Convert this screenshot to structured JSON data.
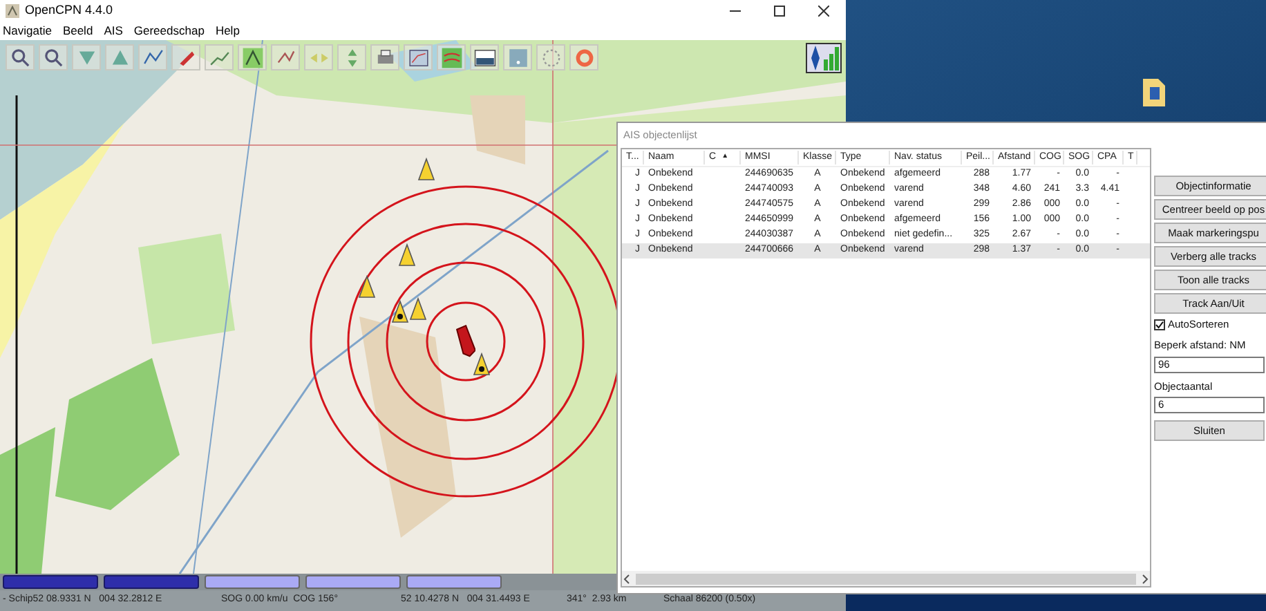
{
  "app_window": {
    "title": "OpenCPN 4.4.0",
    "menu": [
      "Navigatie",
      "Beeld",
      "AIS",
      "Gereedschap",
      "Help"
    ]
  },
  "chart_bar": [
    {
      "selected": true
    },
    {
      "selected": true
    },
    {
      "selected": false
    },
    {
      "selected": false
    },
    {
      "selected": false
    }
  ],
  "status_bar": [
    "- Schip52 08.9331 N   004 32.2812 E",
    "SOG 0.00 km/u  COG 156°",
    "52 10.4278 N   004 31.4493 E",
    "341°  2.93 km",
    "Schaal 86200 (0.50x)"
  ],
  "ais_dialog": {
    "title": "AIS objectenlijst",
    "columns": [
      {
        "label": "T..."
      },
      {
        "label": "Naam"
      },
      {
        "label": "C",
        "sort_arrow": "▲"
      },
      {
        "label": "MMSI"
      },
      {
        "label": "Klasse"
      },
      {
        "label": "Type"
      },
      {
        "label": "Nav. status"
      },
      {
        "label": "Peil..."
      },
      {
        "label": "Afstand"
      },
      {
        "label": "COG"
      },
      {
        "label": "SOG"
      },
      {
        "label": "CPA"
      },
      {
        "label": "T"
      }
    ],
    "rows": [
      {
        "t": "J",
        "naam": "Onbekend",
        "mmsi": "244690635",
        "klasse": "A",
        "type": "Onbekend",
        "nav_status": "afgemeerd",
        "peil": "288",
        "afstand": "1.77",
        "cog": "-",
        "sog": "0.0",
        "cpa": "-",
        "selected": false
      },
      {
        "t": "J",
        "naam": "Onbekend",
        "mmsi": "244740093",
        "klasse": "A",
        "type": "Onbekend",
        "nav_status": "varend",
        "peil": "348",
        "afstand": "4.60",
        "cog": "241",
        "sog": "3.3",
        "cpa": "4.41",
        "selected": false
      },
      {
        "t": "J",
        "naam": "Onbekend",
        "mmsi": "244740575",
        "klasse": "A",
        "type": "Onbekend",
        "nav_status": "varend",
        "peil": "299",
        "afstand": "2.86",
        "cog": "000",
        "sog": "0.0",
        "cpa": "-",
        "selected": false
      },
      {
        "t": "J",
        "naam": "Onbekend",
        "mmsi": "244650999",
        "klasse": "A",
        "type": "Onbekend",
        "nav_status": "afgemeerd",
        "peil": "156",
        "afstand": "1.00",
        "cog": "000",
        "sog": "0.0",
        "cpa": "-",
        "selected": false
      },
      {
        "t": "J",
        "naam": "Onbekend",
        "mmsi": "244030387",
        "klasse": "A",
        "type": "Onbekend",
        "nav_status": "niet gedefin...",
        "peil": "325",
        "afstand": "2.67",
        "cog": "-",
        "sog": "0.0",
        "cpa": "-",
        "selected": false
      },
      {
        "t": "J",
        "naam": "Onbekend",
        "mmsi": "244700666",
        "klasse": "A",
        "type": "Onbekend",
        "nav_status": "varend",
        "peil": "298",
        "afstand": "1.37",
        "cog": "-",
        "sog": "0.0",
        "cpa": "-",
        "selected": true
      }
    ],
    "buttons": [
      "Objectinformatie",
      "Centreer beeld op pos",
      "Maak markeringspu",
      "Verberg alle tracks",
      "Toon alle tracks",
      "Track Aan/Uit"
    ],
    "auto_sort": {
      "label": "AutoSorteren",
      "checked": true
    },
    "fields": [
      {
        "label": "Beperk afstand: NM",
        "value": "96"
      },
      {
        "label": "Objectaantal",
        "value": "6"
      }
    ],
    "close_button": "Sluiten"
  }
}
